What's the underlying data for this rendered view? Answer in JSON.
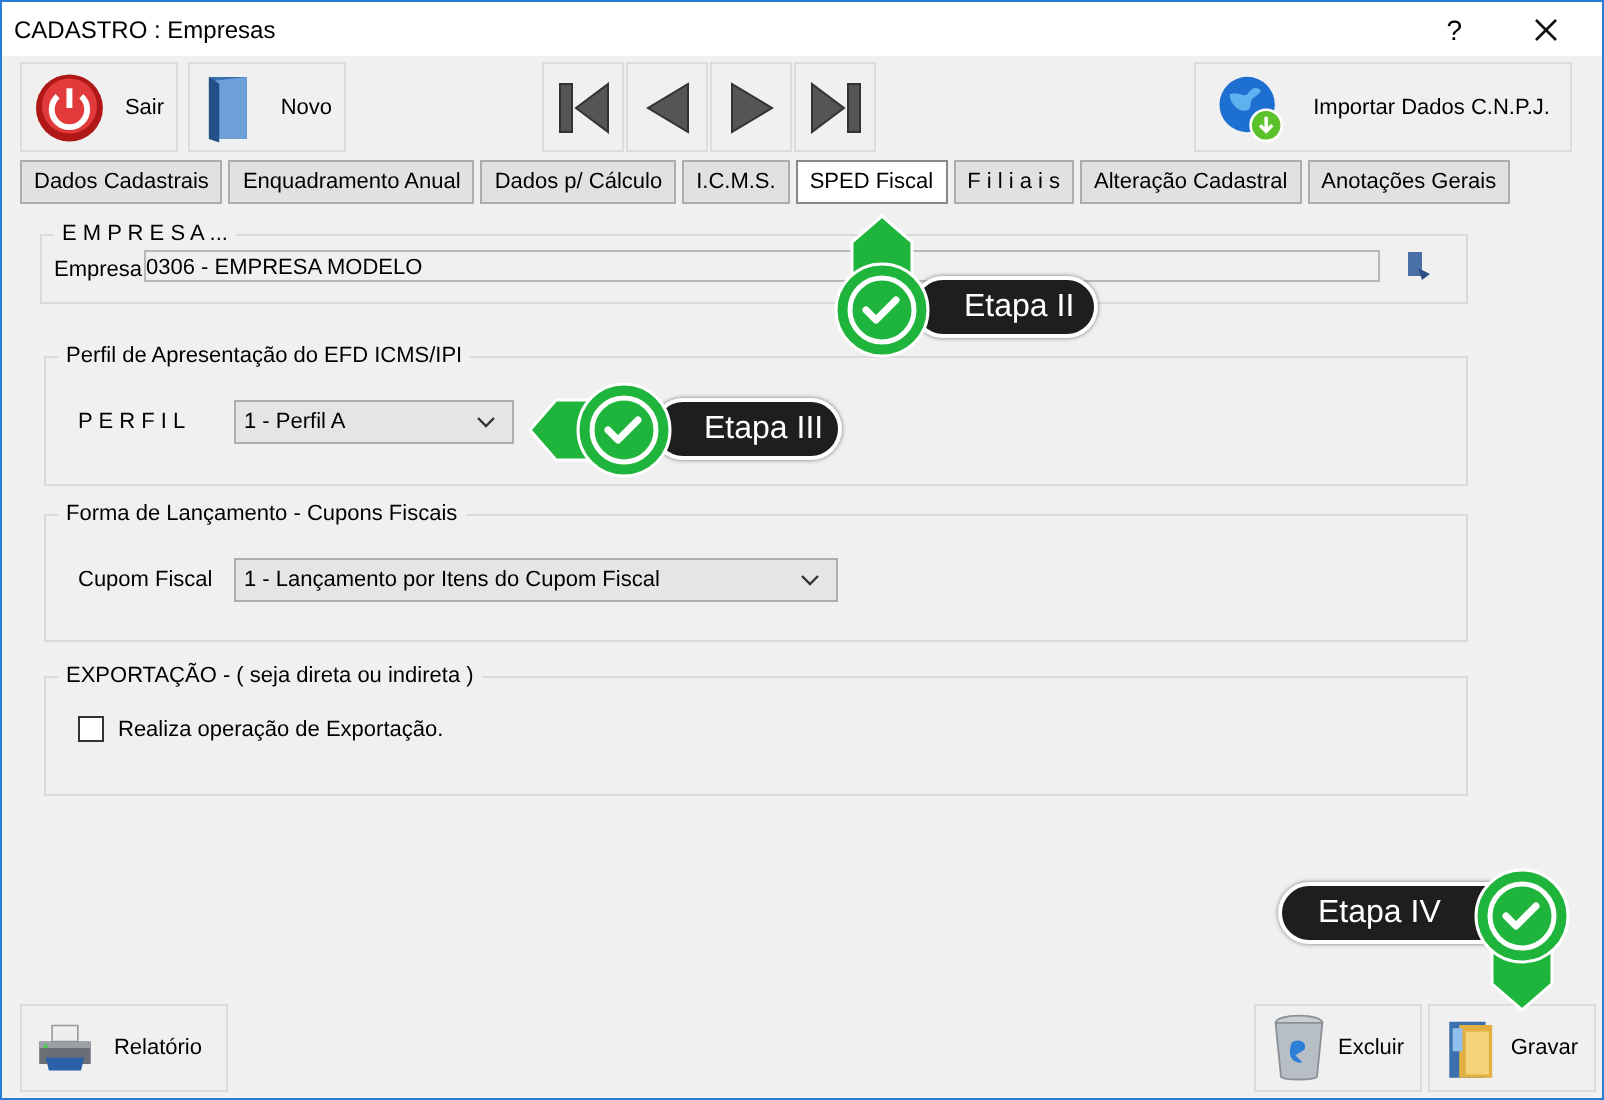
{
  "window": {
    "title": "CADASTRO : Empresas",
    "help": "?"
  },
  "toolbar": [
    {
      "label": "Sair",
      "kind": "exit"
    },
    {
      "label": "Novo",
      "kind": "new"
    }
  ],
  "navigation": [
    {
      "kind": "first"
    },
    {
      "kind": "prev"
    },
    {
      "kind": "next"
    },
    {
      "kind": "last"
    }
  ],
  "import_button": {
    "label": "Importar Dados C.N.P.J."
  },
  "tabs": [
    {
      "label": "Dados Cadastrais",
      "selected": false
    },
    {
      "label": "Enquadramento Anual",
      "selected": false
    },
    {
      "label": "Dados p/ Cálculo",
      "selected": false
    },
    {
      "label": "I.C.M.S.",
      "selected": false
    },
    {
      "label": "SPED Fiscal",
      "selected": true
    },
    {
      "label": "F i l i a i s",
      "selected": false
    },
    {
      "label": "Alteração Cadastral",
      "selected": false
    },
    {
      "label": "Anotações Gerais",
      "selected": false
    }
  ],
  "empresa": {
    "legend": "E M P R E S A ...",
    "label": "Empresa",
    "value": "0306 - EMPRESA MODELO"
  },
  "perfil": {
    "legend": "Perfil de Apresentação do EFD ICMS/IPI",
    "label": "P E R F I L",
    "value": "1 - Perfil A"
  },
  "forma": {
    "legend": "Forma de Lançamento - Cupons Fiscais",
    "label": "Cupom Fiscal",
    "value": "1 - Lançamento por Itens do Cupom Fiscal"
  },
  "exportacao": {
    "legend": "EXPORTAÇÃO - ( seja direta ou indireta )",
    "checkbox": {
      "label": "Realiza operação de Exportação.",
      "checked": false
    }
  },
  "callouts": [
    {
      "label": "Etapa II",
      "kind": "up"
    },
    {
      "label": "Etapa III",
      "kind": "left"
    },
    {
      "label": "Etapa IV",
      "kind": "down"
    }
  ],
  "bottom_left": [
    {
      "label": "Relatório",
      "kind": "print"
    }
  ],
  "bottom_right": [
    {
      "label": "Excluir",
      "kind": "delete"
    },
    {
      "label": "Gravar",
      "kind": "save"
    }
  ]
}
